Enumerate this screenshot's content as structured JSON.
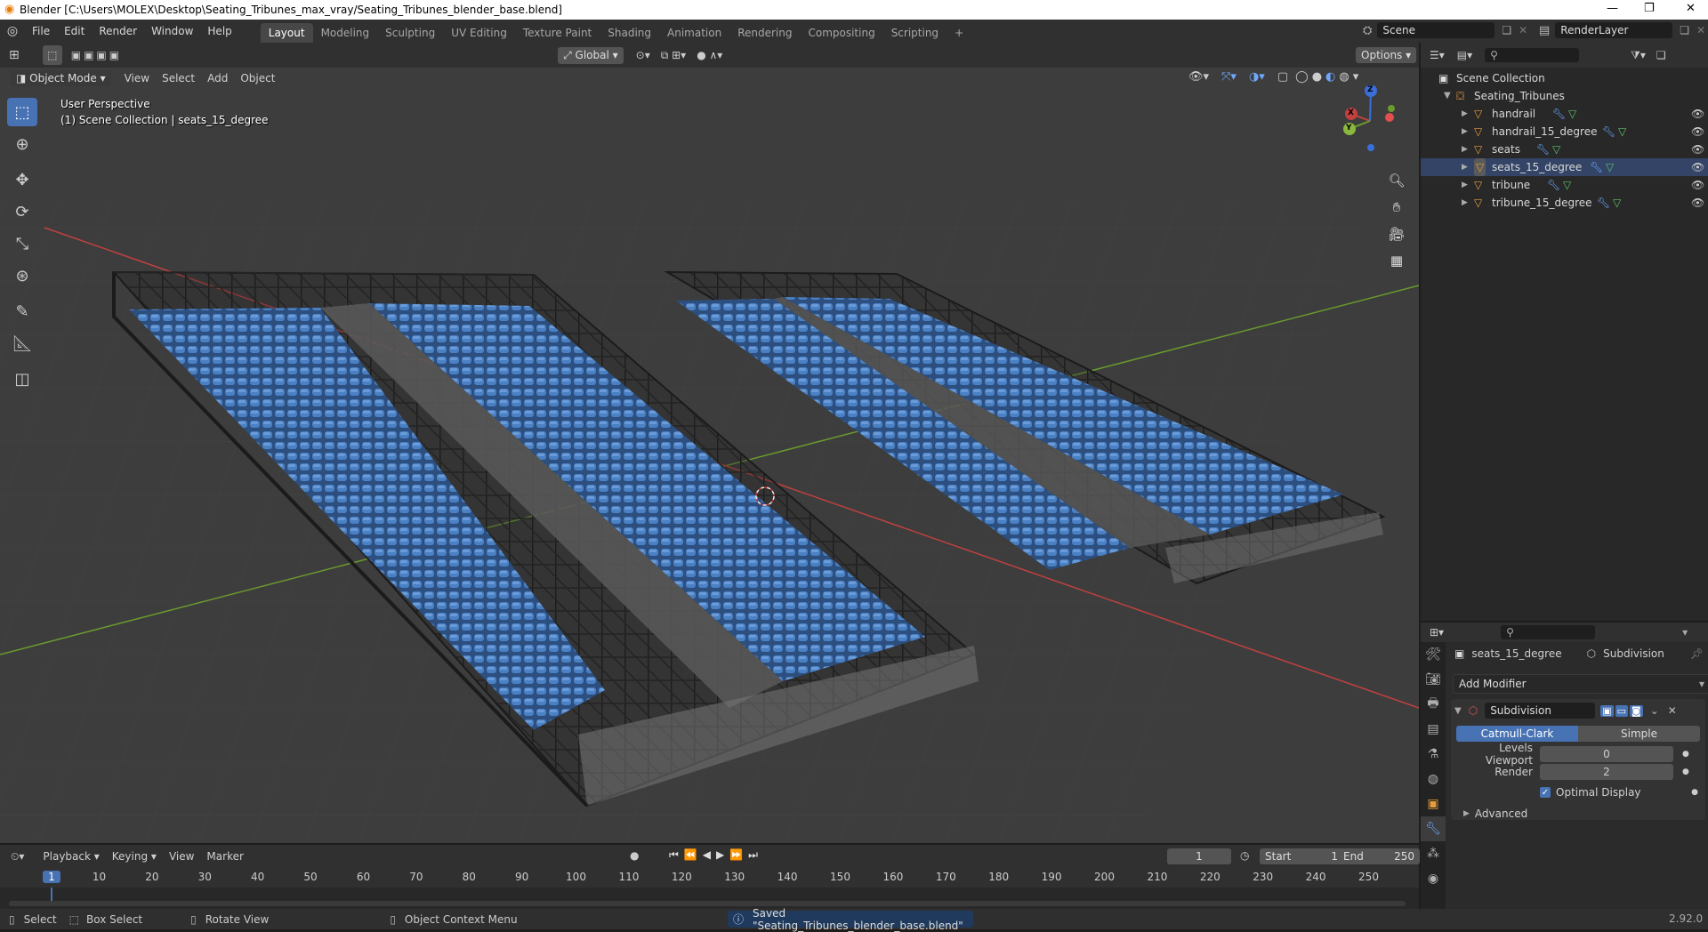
{
  "window": {
    "title": "Blender [C:\\Users\\MOLEX\\Desktop\\Seating_Tribunes_max_vray/Seating_Tribunes_blender_base.blend]",
    "controls": [
      "—",
      "❐",
      "✕"
    ]
  },
  "menubar": {
    "items": [
      "File",
      "Edit",
      "Render",
      "Window",
      "Help"
    ],
    "workspaces": [
      "Layout",
      "Modeling",
      "Sculpting",
      "UV Editing",
      "Texture Paint",
      "Shading",
      "Animation",
      "Rendering",
      "Compositing",
      "Scripting"
    ],
    "active_workspace": "Layout",
    "add_workspace": "+",
    "scene": "Scene",
    "view_layer": "RenderLayer"
  },
  "viewport_header": {
    "transform_orientation": "Global",
    "options": "Options",
    "mode": "Object Mode",
    "menus": [
      "View",
      "Select",
      "Add",
      "Object"
    ]
  },
  "viewport": {
    "perspective": "User Perspective",
    "collection_info": "(1) Scene Collection | seats_15_degree",
    "gizmo_axes": {
      "x": "X",
      "y": "Y",
      "z": "Z"
    },
    "colors": {
      "seat_blue": "#3f72b8",
      "frame": "#262626",
      "grid": "#474747",
      "x_axis": "#c0413f",
      "y_axis": "#6a9a2e"
    }
  },
  "toolbar": {
    "tools": [
      "select-box",
      "cursor",
      "move",
      "rotate",
      "scale",
      "transform",
      "annotate",
      "measure",
      "add-cube"
    ]
  },
  "outliner": {
    "root": "Scene Collection",
    "collection": "Seating_Tribunes",
    "objects": [
      "handrail",
      "handrail_15_degree",
      "seats",
      "seats_15_degree",
      "tribune",
      "tribune_15_degree"
    ],
    "selected": "seats_15_degree"
  },
  "properties": {
    "object_name": "seats_15_degree",
    "modifier_tab": "Subdivision",
    "add_modifier": "Add Modifier",
    "modifier_name": "Subdivision",
    "algorithms": [
      "Catmull-Clark",
      "Simple"
    ],
    "active_algorithm": "Catmull-Clark",
    "levels_viewport_label": "Levels Viewport",
    "levels_viewport": "0",
    "render_label": "Render",
    "render_levels": "2",
    "optimal_display": "Optimal Display",
    "optimal_display_checked": true,
    "advanced": "Advanced"
  },
  "timeline": {
    "menus": [
      "Playback",
      "Keying",
      "View",
      "Marker"
    ],
    "current_frame": "1",
    "start_label": "Start",
    "start": "1",
    "end_label": "End",
    "end": "250",
    "ruler": [
      "1",
      "10",
      "20",
      "30",
      "40",
      "50",
      "60",
      "70",
      "80",
      "90",
      "100",
      "110",
      "120",
      "130",
      "140",
      "150",
      "160",
      "170",
      "180",
      "190",
      "200",
      "210",
      "220",
      "230",
      "240",
      "250"
    ]
  },
  "statusbar": {
    "select": "Select",
    "box_select": "Box Select",
    "rotate_view": "Rotate View",
    "context_menu": "Object Context Menu",
    "message": "Saved \"Seating_Tribunes_blender_base.blend\"",
    "version": "2.92.0"
  }
}
